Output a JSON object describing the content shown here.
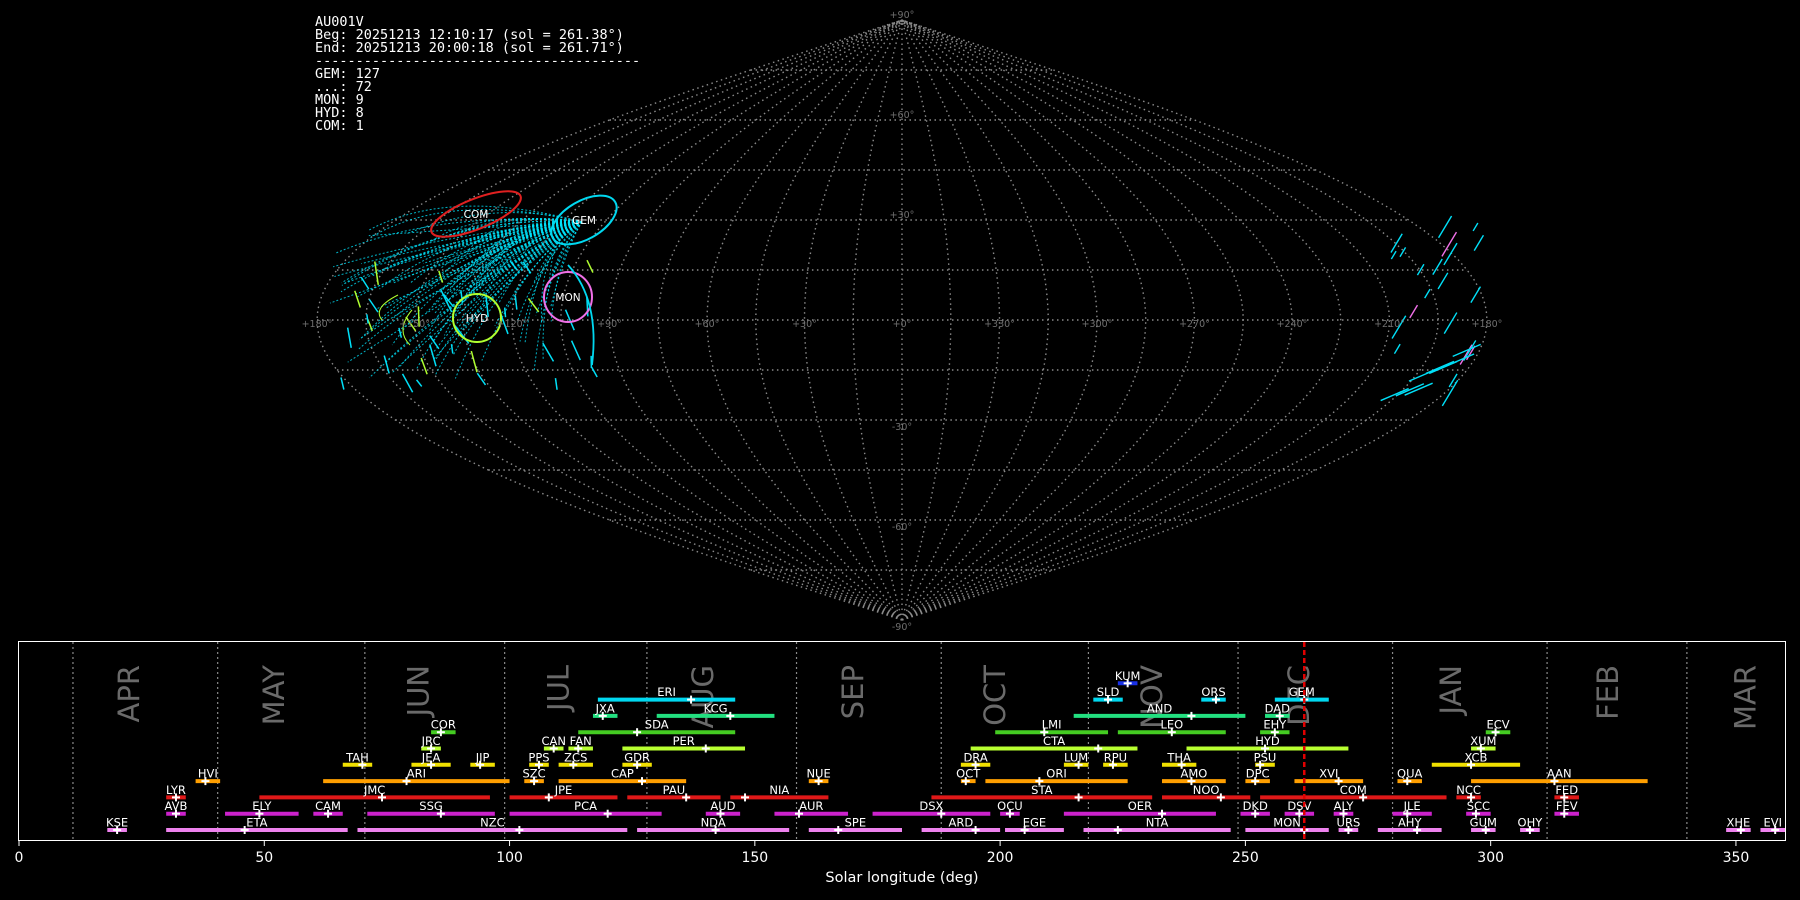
{
  "info": {
    "station": "AU001V",
    "beg": "Beg: 20251213 12:10:17 (sol = 261.38°)",
    "end": "End: 20251213 20:00:18 (sol = 261.71°)",
    "rule": "----------------------------------------",
    "counts": [
      "GEM: 127",
      "...: 72",
      "MON: 9",
      "HYD: 8",
      "COM: 1"
    ]
  },
  "sky_map": {
    "lat_labels": [
      "+90°",
      "+60°",
      "+30°",
      "-30°",
      "-60°",
      "-90°"
    ],
    "lon_labels": [
      "+180°",
      "+150°",
      "+120°",
      "+90°",
      "+60°",
      "+30°",
      "+0°",
      "+330°",
      "+300°",
      "+270°",
      "+240°",
      "+210°",
      "+180°"
    ],
    "grid_color": "#8a8a8a",
    "radiant_labels": [
      "COM",
      "GEM",
      "MON",
      "HYD"
    ],
    "radiant_colors": {
      "COM": "#e02020",
      "GEM": "#00d8f0",
      "MON": "#f070e8",
      "HYD": "#b0ff30"
    },
    "meteor_color": "#00e0f8"
  },
  "chart_data": {
    "type": "timeline",
    "xlabel": "Solar longitude (deg)",
    "xlim": [
      0,
      360
    ],
    "x_ticks": [
      0,
      50,
      100,
      150,
      200,
      250,
      300,
      350
    ],
    "months": [
      {
        "label": "APR",
        "sol": 24.5
      },
      {
        "label": "MAY",
        "sol": 54
      },
      {
        "label": "JUN",
        "sol": 83.5
      },
      {
        "label": "JUL",
        "sol": 112
      },
      {
        "label": "AUG",
        "sol": 141.5
      },
      {
        "label": "SEP",
        "sol": 172
      },
      {
        "label": "OCT",
        "sol": 201
      },
      {
        "label": "NOV",
        "sol": 233
      },
      {
        "label": "DEC",
        "sol": 263
      },
      {
        "label": "JAN",
        "sol": 294
      },
      {
        "label": "FEB",
        "sol": 326
      },
      {
        "label": "MAR",
        "sol": 354
      }
    ],
    "month_boundaries": [
      11,
      40.5,
      70.5,
      99,
      128,
      158.5,
      188,
      218,
      248.5,
      280,
      311.5,
      340
    ],
    "current_sol": 262,
    "current_color": "#e00000",
    "showers": [
      {
        "code": "KSE",
        "start": 18,
        "end": 22,
        "peak": 20,
        "row": 0,
        "color": "#ee82ee"
      },
      {
        "code": "ETA",
        "start": 30,
        "end": 67,
        "peak": 46,
        "row": 0,
        "color": "#ee82ee"
      },
      {
        "code": "NZC",
        "start": 69,
        "end": 124,
        "peak": 102,
        "row": 0,
        "color": "#ee82ee"
      },
      {
        "code": "NDA",
        "start": 126,
        "end": 157,
        "peak": 142,
        "row": 0,
        "color": "#ee82ee"
      },
      {
        "code": "SPE",
        "start": 161,
        "end": 180,
        "peak": 167,
        "row": 0,
        "color": "#ee82ee"
      },
      {
        "code": "ARD",
        "start": 184,
        "end": 200,
        "peak": 195,
        "row": 0,
        "color": "#ee82ee"
      },
      {
        "code": "EGE",
        "start": 201,
        "end": 213,
        "peak": 205,
        "row": 0,
        "color": "#ee82ee"
      },
      {
        "code": "NTA",
        "start": 217,
        "end": 247,
        "peak": 224,
        "row": 0,
        "color": "#ee82ee"
      },
      {
        "code": "MON",
        "start": 250,
        "end": 267,
        "peak": 262,
        "row": 0,
        "color": "#ee82ee"
      },
      {
        "code": "URS",
        "start": 269,
        "end": 273,
        "peak": 271,
        "row": 0,
        "color": "#ee82ee"
      },
      {
        "code": "AHY",
        "start": 277,
        "end": 290,
        "peak": 285,
        "row": 0,
        "color": "#ee82ee"
      },
      {
        "code": "GUM",
        "start": 296,
        "end": 301,
        "peak": 299,
        "row": 0,
        "color": "#ee82ee"
      },
      {
        "code": "OHY",
        "start": 306,
        "end": 310,
        "peak": 308,
        "row": 0,
        "color": "#ee82ee"
      },
      {
        "code": "XHE",
        "start": 348,
        "end": 353,
        "peak": 351,
        "row": 0,
        "color": "#ee82ee"
      },
      {
        "code": "EVI",
        "start": 355,
        "end": 360,
        "peak": 358,
        "row": 0,
        "color": "#ee82ee"
      },
      {
        "code": "AVB",
        "start": 30,
        "end": 34,
        "peak": 32,
        "row": 1,
        "color": "#cc22cc"
      },
      {
        "code": "ELY",
        "start": 42,
        "end": 57,
        "peak": 49,
        "row": 1,
        "color": "#cc22cc"
      },
      {
        "code": "CAM",
        "start": 60,
        "end": 66,
        "peak": 63,
        "row": 1,
        "color": "#cc22cc"
      },
      {
        "code": "SSG",
        "start": 71,
        "end": 97,
        "peak": 86,
        "row": 1,
        "color": "#cc22cc"
      },
      {
        "code": "PCA",
        "start": 100,
        "end": 131,
        "peak": 120,
        "row": 1,
        "color": "#cc22cc"
      },
      {
        "code": "AUD",
        "start": 140,
        "end": 147,
        "peak": 143,
        "row": 1,
        "color": "#cc22cc"
      },
      {
        "code": "AUR",
        "start": 154,
        "end": 169,
        "peak": 159,
        "row": 1,
        "color": "#cc22cc"
      },
      {
        "code": "DSX",
        "start": 174,
        "end": 198,
        "peak": 188,
        "row": 1,
        "color": "#cc22cc"
      },
      {
        "code": "OCU",
        "start": 200,
        "end": 204,
        "peak": 202,
        "row": 1,
        "color": "#cc22cc"
      },
      {
        "code": "OER",
        "start": 213,
        "end": 244,
        "peak": 233,
        "row": 1,
        "color": "#cc22cc"
      },
      {
        "code": "DKD",
        "start": 249,
        "end": 255,
        "peak": 252,
        "row": 1,
        "color": "#cc22cc"
      },
      {
        "code": "DSV",
        "start": 258,
        "end": 264,
        "peak": 261,
        "row": 1,
        "color": "#cc22cc"
      },
      {
        "code": "ALY",
        "start": 268,
        "end": 272,
        "peak": 270,
        "row": 1,
        "color": "#cc22cc"
      },
      {
        "code": "JLE",
        "start": 280,
        "end": 288,
        "peak": 283,
        "row": 1,
        "color": "#cc22cc"
      },
      {
        "code": "SCC",
        "start": 295,
        "end": 300,
        "peak": 297,
        "row": 1,
        "color": "#cc22cc"
      },
      {
        "code": "FEV",
        "start": 313,
        "end": 318,
        "peak": 315,
        "row": 1,
        "color": "#cc22cc"
      },
      {
        "code": "LYR",
        "start": 30,
        "end": 34,
        "peak": 32,
        "row": 2,
        "color": "#e01818"
      },
      {
        "code": "JMC",
        "start": 49,
        "end": 96,
        "peak": 74,
        "row": 2,
        "color": "#e01818"
      },
      {
        "code": "JPE",
        "start": 100,
        "end": 122,
        "peak": 108,
        "row": 2,
        "color": "#e01818"
      },
      {
        "code": "PAU",
        "start": 124,
        "end": 143,
        "peak": 136,
        "row": 2,
        "color": "#e01818"
      },
      {
        "code": "NIA",
        "start": 145,
        "end": 165,
        "peak": 148,
        "row": 2,
        "color": "#e01818"
      },
      {
        "code": "STA",
        "start": 186,
        "end": 231,
        "peak": 216,
        "row": 2,
        "color": "#e01818"
      },
      {
        "code": "NOO",
        "start": 233,
        "end": 251,
        "peak": 245,
        "row": 2,
        "color": "#e01818"
      },
      {
        "code": "COM",
        "start": 253,
        "end": 291,
        "peak": 274,
        "row": 2,
        "color": "#e01818"
      },
      {
        "code": "NCC",
        "start": 293,
        "end": 298,
        "peak": 296,
        "row": 2,
        "color": "#e01818"
      },
      {
        "code": "FED",
        "start": 313,
        "end": 318,
        "peak": 315,
        "row": 2,
        "color": "#e01818"
      },
      {
        "code": "HVI",
        "start": 36,
        "end": 41,
        "peak": 38,
        "row": 3,
        "color": "#ff9f00"
      },
      {
        "code": "ARI",
        "start": 62,
        "end": 100,
        "peak": 79,
        "row": 3,
        "color": "#ff9f00"
      },
      {
        "code": "SZC",
        "start": 103,
        "end": 107,
        "peak": 105,
        "row": 3,
        "color": "#ff9f00"
      },
      {
        "code": "CAP",
        "start": 110,
        "end": 136,
        "peak": 127,
        "row": 3,
        "color": "#ff9f00"
      },
      {
        "code": "NUE",
        "start": 161,
        "end": 165,
        "peak": 163,
        "row": 3,
        "color": "#ff9f00"
      },
      {
        "code": "OCT",
        "start": 192,
        "end": 195,
        "peak": 193,
        "row": 3,
        "color": "#ff9f00"
      },
      {
        "code": "ORI",
        "start": 197,
        "end": 226,
        "peak": 208,
        "row": 3,
        "color": "#ff9f00"
      },
      {
        "code": "AMO",
        "start": 233,
        "end": 246,
        "peak": 239,
        "row": 3,
        "color": "#ff9f00"
      },
      {
        "code": "DPC",
        "start": 250,
        "end": 255,
        "peak": 252,
        "row": 3,
        "color": "#ff9f00"
      },
      {
        "code": "XVI",
        "start": 260,
        "end": 274,
        "peak": 269,
        "row": 3,
        "color": "#ff9f00"
      },
      {
        "code": "QUA",
        "start": 281,
        "end": 286,
        "peak": 283,
        "row": 3,
        "color": "#ff9f00"
      },
      {
        "code": "AAN",
        "start": 296,
        "end": 332,
        "peak": 313,
        "row": 3,
        "color": "#ff9f00"
      },
      {
        "code": "TAH",
        "start": 66,
        "end": 72,
        "peak": 70,
        "row": 4,
        "color": "#f0e000"
      },
      {
        "code": "JEA",
        "start": 80,
        "end": 88,
        "peak": 84,
        "row": 4,
        "color": "#f0e000"
      },
      {
        "code": "JIP",
        "start": 92,
        "end": 97,
        "peak": 94,
        "row": 4,
        "color": "#f0e000"
      },
      {
        "code": "PPS",
        "start": 104,
        "end": 108,
        "peak": 106,
        "row": 4,
        "color": "#f0e000"
      },
      {
        "code": "ZCS",
        "start": 110,
        "end": 117,
        "peak": 113,
        "row": 4,
        "color": "#f0e000"
      },
      {
        "code": "GDR",
        "start": 123,
        "end": 129,
        "peak": 126,
        "row": 4,
        "color": "#f0e000"
      },
      {
        "code": "DRA",
        "start": 192,
        "end": 198,
        "peak": 195,
        "row": 4,
        "color": "#f0e000"
      },
      {
        "code": "LUM",
        "start": 213,
        "end": 218,
        "peak": 216,
        "row": 4,
        "color": "#f0e000"
      },
      {
        "code": "RPU",
        "start": 221,
        "end": 226,
        "peak": 223,
        "row": 4,
        "color": "#f0e000"
      },
      {
        "code": "THA",
        "start": 233,
        "end": 240,
        "peak": 237,
        "row": 4,
        "color": "#f0e000"
      },
      {
        "code": "PSU",
        "start": 252,
        "end": 256,
        "peak": 253,
        "row": 4,
        "color": "#f0e000"
      },
      {
        "code": "XCB",
        "start": 288,
        "end": 306,
        "peak": 296,
        "row": 4,
        "color": "#f0e000"
      },
      {
        "code": "JRC",
        "start": 82,
        "end": 86,
        "peak": 84,
        "row": 5,
        "color": "#b8ff30"
      },
      {
        "code": "CAN",
        "start": 107,
        "end": 111,
        "peak": 109,
        "row": 5,
        "color": "#b8ff30"
      },
      {
        "code": "FAN",
        "start": 112,
        "end": 117,
        "peak": 114,
        "row": 5,
        "color": "#b8ff30"
      },
      {
        "code": "PER",
        "start": 123,
        "end": 148,
        "peak": 140,
        "row": 5,
        "color": "#b8ff30"
      },
      {
        "code": "CTA",
        "start": 194,
        "end": 228,
        "peak": 220,
        "row": 5,
        "color": "#b8ff30"
      },
      {
        "code": "HYD",
        "start": 238,
        "end": 271,
        "peak": 254,
        "row": 5,
        "color": "#b8ff30"
      },
      {
        "code": "XUM",
        "start": 296,
        "end": 301,
        "peak": 298,
        "row": 5,
        "color": "#b8ff30"
      },
      {
        "code": "COR",
        "start": 84,
        "end": 89,
        "peak": 86,
        "row": 6,
        "color": "#44cc22"
      },
      {
        "code": "SDA",
        "start": 114,
        "end": 146,
        "peak": 126,
        "row": 6,
        "color": "#44cc22"
      },
      {
        "code": "LMI",
        "start": 199,
        "end": 222,
        "peak": 209,
        "row": 6,
        "color": "#44cc22"
      },
      {
        "code": "LEO",
        "start": 224,
        "end": 246,
        "peak": 235,
        "row": 6,
        "color": "#44cc22"
      },
      {
        "code": "EHY",
        "start": 253,
        "end": 259,
        "peak": 256,
        "row": 6,
        "color": "#44cc22"
      },
      {
        "code": "ECV",
        "start": 299,
        "end": 304,
        "peak": 301,
        "row": 6,
        "color": "#44cc22"
      },
      {
        "code": "JXA",
        "start": 117,
        "end": 122,
        "peak": 119,
        "row": 7,
        "color": "#22e080"
      },
      {
        "code": "KCG",
        "start": 130,
        "end": 154,
        "peak": 145,
        "row": 7,
        "color": "#22e080"
      },
      {
        "code": "AND",
        "start": 215,
        "end": 250,
        "peak": 239,
        "row": 7,
        "color": "#22e080"
      },
      {
        "code": "DAD",
        "start": 254,
        "end": 259,
        "peak": 257,
        "row": 7,
        "color": "#22e080"
      },
      {
        "code": "ERI",
        "start": 118,
        "end": 146,
        "peak": 137,
        "row": 8,
        "color": "#00d8f0"
      },
      {
        "code": "SLD",
        "start": 219,
        "end": 225,
        "peak": 222,
        "row": 8,
        "color": "#00d8f0"
      },
      {
        "code": "ORS",
        "start": 241,
        "end": 246,
        "peak": 244,
        "row": 8,
        "color": "#00d8f0"
      },
      {
        "code": "GEM",
        "start": 256,
        "end": 267,
        "peak": 262,
        "row": 8,
        "color": "#00d8f0"
      },
      {
        "code": "KUM",
        "start": 224,
        "end": 228,
        "peak": 226,
        "row": 9,
        "color": "#1830e8"
      }
    ]
  }
}
